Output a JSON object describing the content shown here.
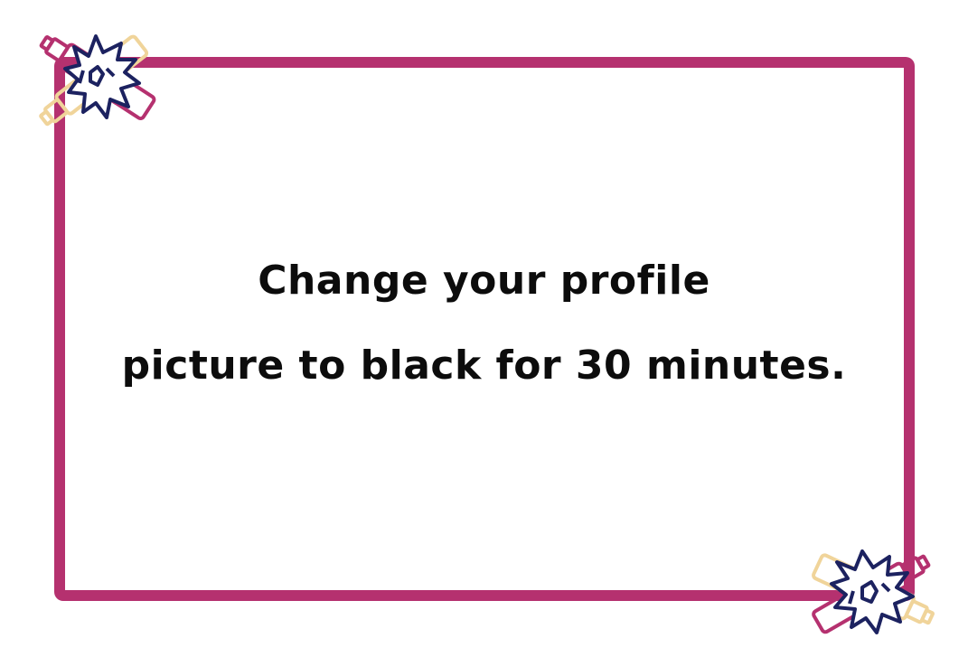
{
  "message": {
    "line1": "Change your profile",
    "line2": "picture to black for 30 minutes."
  },
  "colors": {
    "frame": "#b5316f",
    "bottle_cream": "#f0d49a",
    "bottle_magenta": "#b5316f",
    "ink_navy": "#1c2260",
    "text": "#0c0c0c",
    "background": "#ffffff"
  },
  "icons": {
    "corner_decoration": "crossed-bottles-splash-icon"
  }
}
